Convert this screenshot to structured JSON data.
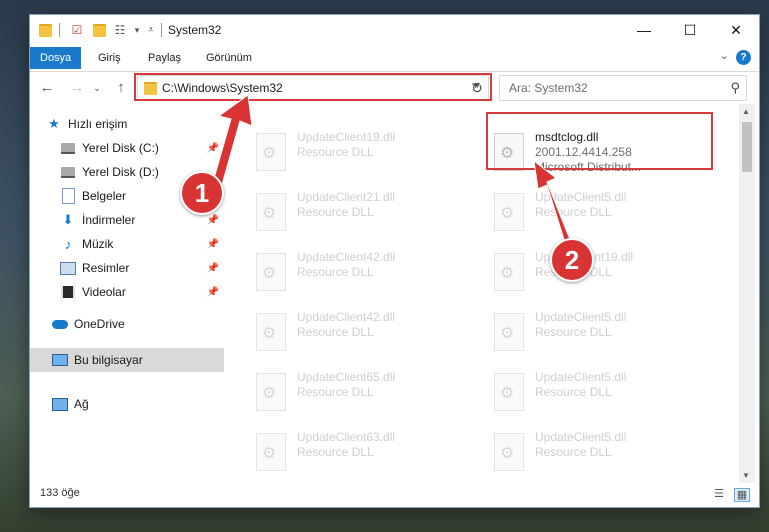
{
  "window": {
    "title": "System32",
    "controls": {
      "minimize": "—",
      "maximize": "☐",
      "close": "✕"
    }
  },
  "ribbon": {
    "tabs": [
      {
        "label": "Dosya",
        "active": true
      },
      {
        "label": "Giriş"
      },
      {
        "label": "Paylaş"
      },
      {
        "label": "Görünüm"
      }
    ],
    "help": "?"
  },
  "address": {
    "path": "C:\\Windows\\System32"
  },
  "search": {
    "placeholder": "Ara: System32"
  },
  "sidebar": {
    "items": [
      {
        "label": "Hızlı erişim",
        "icon": "star-icon"
      },
      {
        "label": "Yerel Disk (C:)",
        "icon": "drive-icon"
      },
      {
        "label": "Yerel Disk (D:)",
        "icon": "drive-icon"
      },
      {
        "label": "Belgeler",
        "icon": "documents-icon"
      },
      {
        "label": "İndirmeler",
        "icon": "download-icon"
      },
      {
        "label": "Müzik",
        "icon": "music-icon"
      },
      {
        "label": "Resimler",
        "icon": "pictures-icon"
      },
      {
        "label": "Videolar",
        "icon": "videos-icon"
      },
      {
        "label": "OneDrive",
        "icon": "cloud-icon"
      },
      {
        "label": "Bu bilgisayar",
        "icon": "computer-icon"
      },
      {
        "label": "Ağ",
        "icon": "network-icon"
      }
    ]
  },
  "files": {
    "left": [
      {
        "name": "UpdateClient19.dll",
        "desc": "Resource DLL"
      },
      {
        "name": "UpdateClient21.dll",
        "desc": "Resource DLL"
      },
      {
        "name": "UpdateClient42.dll",
        "desc": "Resource DLL"
      },
      {
        "name": "UpdateClient42.dll",
        "desc": "Resource DLL"
      },
      {
        "name": "UpdateClient65.dll",
        "desc": "Resource DLL"
      },
      {
        "name": "UpdateClient63.dll",
        "desc": "Resource DLL"
      }
    ],
    "highlighted": {
      "name": "msdtclog.dll",
      "version": "2001.12.4414.258",
      "company": "Microsoft Distribut..."
    },
    "right": [
      {
        "name": "UpdateClient5.dll",
        "desc": "Resource DLL"
      },
      {
        "name": "UpdateClient19.dll",
        "desc": "Resource DLL"
      },
      {
        "name": "UpdateClient5.dll",
        "desc": "Resource DLL"
      },
      {
        "name": "UpdateClient5.dll",
        "desc": "Resource DLL"
      },
      {
        "name": "UpdateClient5.dll",
        "desc": "Resource DLL"
      }
    ]
  },
  "status": {
    "count": "133 öğe"
  },
  "annotations": {
    "step1": "1",
    "step2": "2",
    "color": "#d93434"
  }
}
